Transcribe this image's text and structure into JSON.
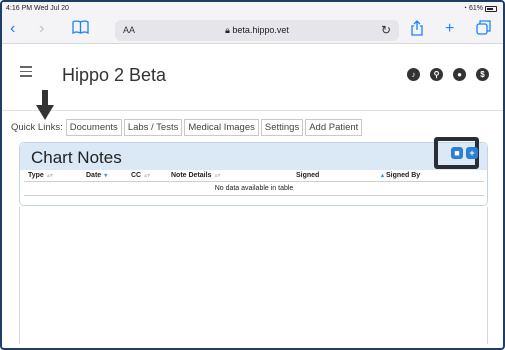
{
  "statusbar": {
    "time": "4:16 PM  Wed Jul 20",
    "battery": "61%"
  },
  "safari": {
    "host": "beta.hippo.vet",
    "aa": "AA",
    "icons": [
      "back-icon",
      "forward-icon",
      "bookmarks-icon",
      "lock-icon",
      "reload-icon",
      "share-icon",
      "new-tab-icon",
      "tabs-icon"
    ]
  },
  "app": {
    "title": "Hippo 2 Beta",
    "header_icons": [
      "notifications-icon",
      "search-icon",
      "location-icon",
      "dollar-icon"
    ]
  },
  "quick_links": {
    "label": "Quick Links:",
    "items": [
      "Documents",
      "Labs / Tests",
      "Medical Images",
      "Settings",
      "Add Patient"
    ]
  },
  "chart_notes": {
    "title": "Chart Notes",
    "columns": [
      "Type",
      "Date",
      "CC",
      "Note Details",
      "Signed",
      "Signed By"
    ],
    "empty_message": "No data available in table",
    "buttons": [
      "print-icon",
      "add-icon"
    ]
  },
  "colors": {
    "accent": "#2d7fd3",
    "panel_header": "#dbe9f6",
    "safari_blue": "#1a82fb",
    "highlight_box": "#2a2d33"
  }
}
